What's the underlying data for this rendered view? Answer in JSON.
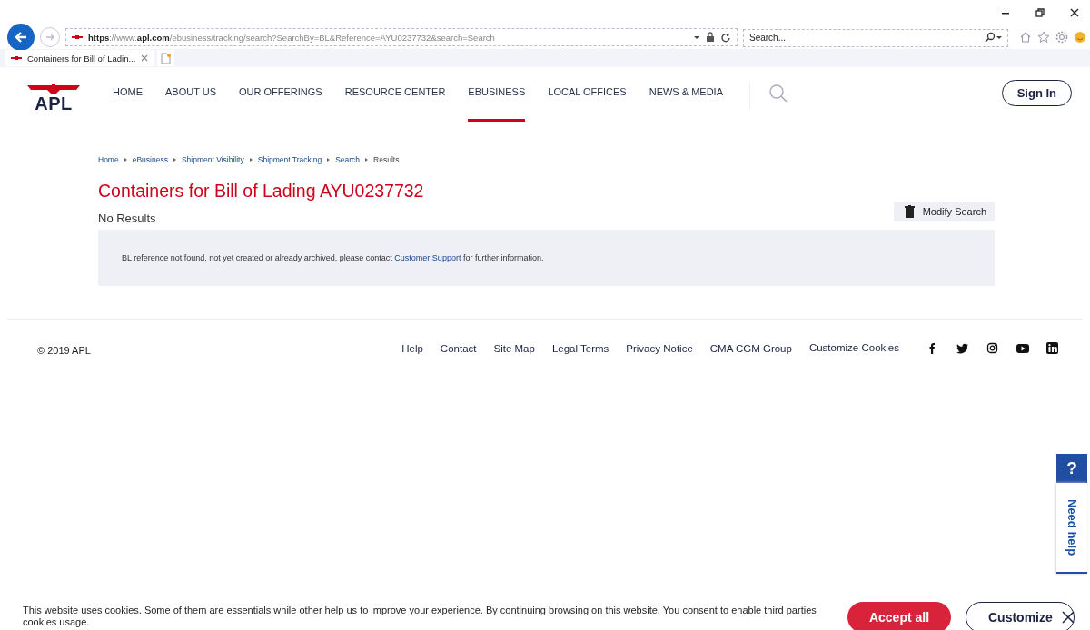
{
  "browser": {
    "address": "**https**://www.**apl.com**/ebusiness/tracking/search?SearchBy=BL&Reference=AYU0237732&search=Search",
    "search_placeholder": "Search...",
    "tabs": [
      {
        "label": "Containers for Bill of Ladin...",
        "selected": true
      }
    ]
  },
  "header": {
    "logo": "APL",
    "nav": [
      {
        "label": "HOME",
        "selected": false
      },
      {
        "label": "ABOUT US",
        "selected": false
      },
      {
        "label": "OUR OFFERINGS",
        "selected": false
      },
      {
        "label": "RESOURCE CENTER",
        "selected": false
      },
      {
        "label": "EBUSINESS",
        "selected": true
      },
      {
        "label": "LOCAL OFFICES",
        "selected": false
      },
      {
        "label": "NEWS & MEDIA",
        "selected": false
      }
    ],
    "sign_in": "Sign In"
  },
  "breadcrumb": [
    {
      "label": "Home",
      "kind": "link"
    },
    {
      "label": "eBusiness",
      "kind": "link"
    },
    {
      "label": "Shipment Visibility",
      "kind": "link"
    },
    {
      "label": "Shipment Tracking",
      "kind": "link"
    },
    {
      "label": "Search",
      "kind": "link"
    },
    {
      "label": "Results",
      "kind": "current"
    }
  ],
  "title": "Containers for Bill of Lading AYU0237732",
  "result_status": "No Results",
  "modify_button": "Modify Search",
  "message": {
    "before": "BL reference not found, not yet created or already archived, please contact ",
    "link": "Customer Support",
    "after": " for further information."
  },
  "footer": {
    "copyright": "© 2019 APL",
    "links": [
      "Help",
      "Contact",
      "Site Map",
      "Legal Terms",
      "Privacy Notice",
      "CMA CGM Group",
      "Customize Cookies"
    ],
    "social": [
      {
        "kind": "facebook"
      },
      {
        "kind": "twitter"
      },
      {
        "kind": "instagram"
      },
      {
        "kind": "youtube"
      },
      {
        "kind": "linkedin"
      }
    ]
  },
  "cookie_bar": {
    "text": "This website uses cookies. Some of them are essentials while other help us to improve your experience. By continuing browsing on this website. You consent to enable third parties cookies usage.",
    "accept": "Accept all",
    "customize": "Customize"
  },
  "help_tab": {
    "icon": "?",
    "label": "Need help"
  }
}
